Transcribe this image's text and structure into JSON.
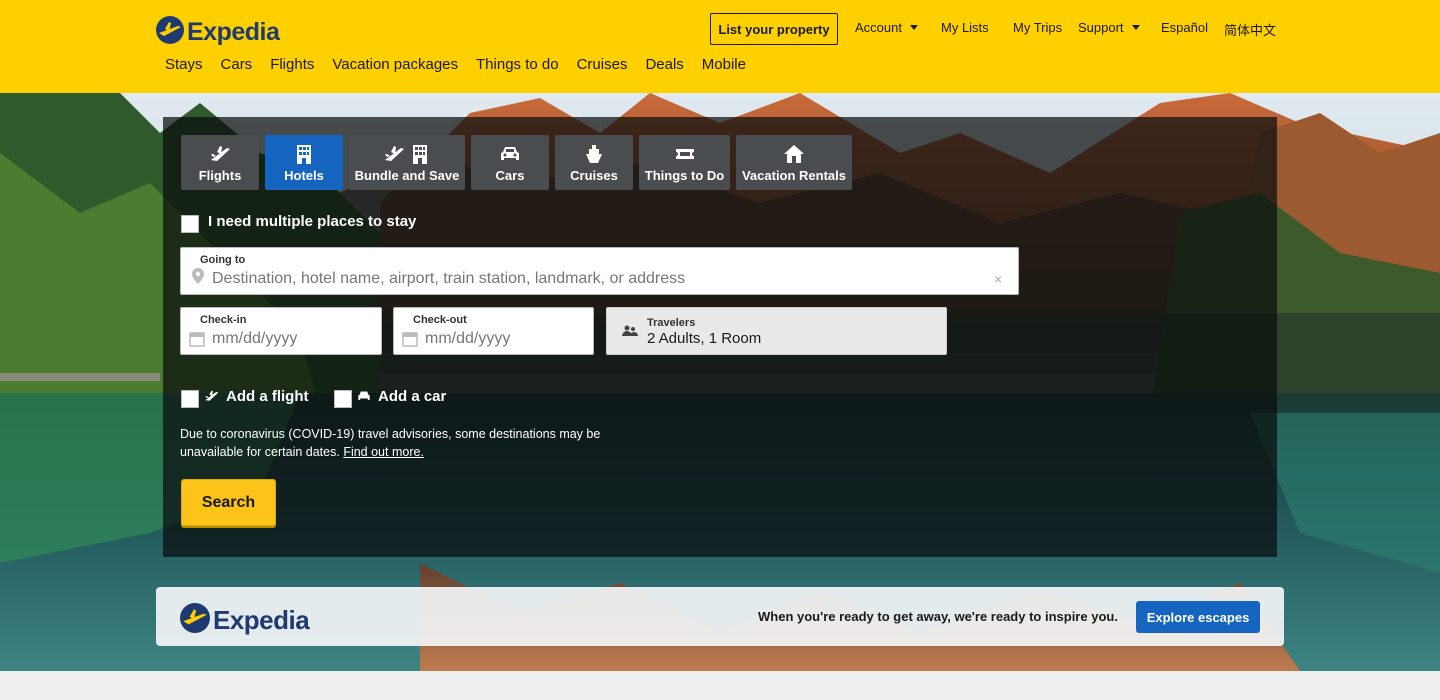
{
  "header": {
    "brand": "Expedia",
    "list_property": "List your property",
    "util_nav": [
      {
        "label": "Account",
        "dropdown": true
      },
      {
        "label": "My Lists",
        "dropdown": false
      },
      {
        "label": "My Trips",
        "dropdown": false
      },
      {
        "label": "Support",
        "dropdown": true
      },
      {
        "label": "Español",
        "dropdown": false
      },
      {
        "label": "简体中文",
        "dropdown": false
      }
    ],
    "main_nav": [
      "Stays",
      "Cars",
      "Flights",
      "Vacation packages",
      "Things to do",
      "Cruises",
      "Deals",
      "Mobile"
    ]
  },
  "search": {
    "tabs": [
      {
        "label": "Flights",
        "icon": "plane-icon",
        "active": false
      },
      {
        "label": "Hotels",
        "icon": "building-icon",
        "active": true
      },
      {
        "label": "Bundle and Save",
        "icon": "plane-building-icon",
        "active": false
      },
      {
        "label": "Cars",
        "icon": "car-icon",
        "active": false
      },
      {
        "label": "Cruises",
        "icon": "ship-icon",
        "active": false
      },
      {
        "label": "Things to Do",
        "icon": "ticket-icon",
        "active": false
      },
      {
        "label": "Vacation Rentals",
        "icon": "house-icon",
        "active": false
      }
    ],
    "multiple_places_label": "I need multiple places to stay",
    "going_to": {
      "label": "Going to",
      "placeholder": "Destination, hotel name, airport, train station, landmark, or address"
    },
    "check_in": {
      "label": "Check-in",
      "placeholder": "mm/dd/yyyy"
    },
    "check_out": {
      "label": "Check-out",
      "placeholder": "mm/dd/yyyy"
    },
    "travelers": {
      "label": "Travelers",
      "value": "2 Adults, 1 Room"
    },
    "add_flight": "Add a flight",
    "add_car": "Add a car",
    "notice_text": "Due to coronavirus (COVID-19) travel advisories, some destinations may be unavailable for certain dates.",
    "notice_link": "Find out more.",
    "search_button": "Search"
  },
  "banner": {
    "brand": "Expedia",
    "message": "When you're ready to get away, we're ready to inspire you.",
    "button": "Explore escapes"
  },
  "colors": {
    "header_bg": "#ffd000",
    "brand_navy": "#1f3a70",
    "active_tab": "#1565c0",
    "search_button": "#fcc419"
  }
}
